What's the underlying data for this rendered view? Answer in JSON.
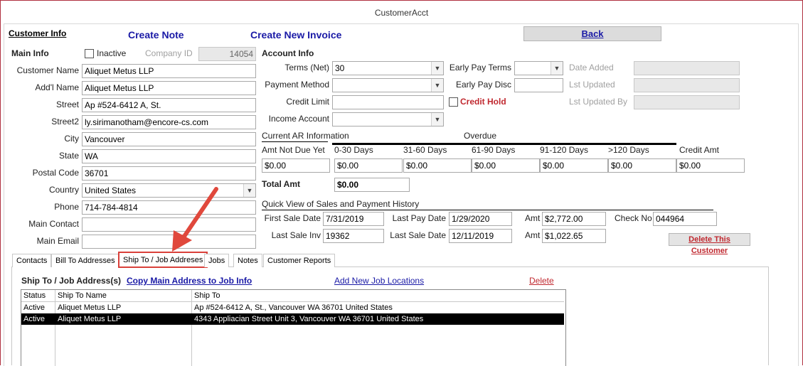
{
  "window": {
    "title": "CustomerAcct"
  },
  "top_links": {
    "customer_info": "Customer Info",
    "create_note": "Create Note",
    "create_invoice": "Create New Invoice",
    "back": "Back"
  },
  "main_info": {
    "section_label": "Main Info",
    "inactive_label": "Inactive",
    "company_id_label": "Company ID",
    "company_id": "14054",
    "fields": [
      {
        "label": "Customer Name",
        "value": "Aliquet Metus LLP"
      },
      {
        "label": "Add'l Name",
        "value": "Aliquet Metus LLP"
      },
      {
        "label": "Street",
        "value": "Ap #524-6412 A, St."
      },
      {
        "label": "Street2",
        "value": "ly.sirimanotham@encore-cs.com"
      },
      {
        "label": "City",
        "value": "Vancouver"
      },
      {
        "label": "State",
        "value": "WA"
      },
      {
        "label": "Postal Code",
        "value": "36701"
      },
      {
        "label": "Country",
        "value": "United States"
      },
      {
        "label": "Phone",
        "value": "714-784-4814"
      },
      {
        "label": "Main Contact",
        "value": ""
      },
      {
        "label": "Main Email",
        "value": ""
      }
    ]
  },
  "account_info": {
    "section_label": "Account Info",
    "terms_label": "Terms (Net)",
    "terms_value": "30",
    "payment_method_label": "Payment Method",
    "payment_method_value": "",
    "credit_limit_label": "Credit Limit",
    "credit_limit_value": "",
    "income_account_label": "Income Account",
    "income_account_value": "",
    "early_pay_terms_label": "Early Pay Terms",
    "early_pay_disc_label": "Early Pay Disc",
    "credit_hold_label": "Credit Hold",
    "date_added_label": "Date Added",
    "lst_updated_label": "Lst Updated",
    "lst_updated_by_label": "Lst Updated By"
  },
  "ar": {
    "title": "Current AR Information",
    "overdue_label": "Overdue",
    "columns": [
      "Amt Not Due Yet",
      "0-30 Days",
      "31-60 Days",
      "61-90 Days",
      "91-120 Days",
      ">120 Days",
      "Credit Amt"
    ],
    "values": [
      "$0.00",
      "$0.00",
      "$0.00",
      "$0.00",
      "$0.00",
      "$0.00",
      "$0.00"
    ],
    "total_label": "Total Amt",
    "total_value": "$0.00"
  },
  "history": {
    "title": "Quick View of Sales and Payment History",
    "first_sale_date_label": "First Sale Date",
    "first_sale_date": "7/31/2019",
    "last_pay_date_label": "Last Pay Date",
    "last_pay_date": "1/29/2020",
    "amt_label": "Amt",
    "amt1": "$2,772.00",
    "check_no_label": "Check No",
    "check_no": "044964",
    "last_sale_inv_label": "Last Sale Inv",
    "last_sale_inv": "19362",
    "last_sale_date_label": "Last Sale Date",
    "last_sale_date": "12/11/2019",
    "amt2": "$1,022.65",
    "delete_customer": "Delete This Customer"
  },
  "tabs": [
    "Contacts",
    "Bill To Addresses",
    "Ship To / Job Addreses",
    "Jobs",
    "Notes",
    "Customer Reports"
  ],
  "ship_to": {
    "title": "Ship To / Job Address(s)",
    "copy_link": "Copy Main Address to Job Info",
    "add_link": "Add New Job Locations",
    "delete_link": "Delete",
    "columns": [
      "Status",
      "Ship To Name",
      "Ship To"
    ],
    "rows": [
      {
        "status": "Active",
        "name": "Aliquet Metus LLP",
        "address": "Ap #524-6412 A, St., Vancouver WA  36701 United States"
      },
      {
        "status": "Active",
        "name": "Aliquet Metus LLP",
        "address": "4343 Appliacian Street Unit 3, Vancouver WA  36701 United States"
      }
    ]
  },
  "colors": {
    "accent_blue": "#1a1aa6",
    "danger_red": "#c0282f",
    "annotation_red": "#e0483c"
  }
}
